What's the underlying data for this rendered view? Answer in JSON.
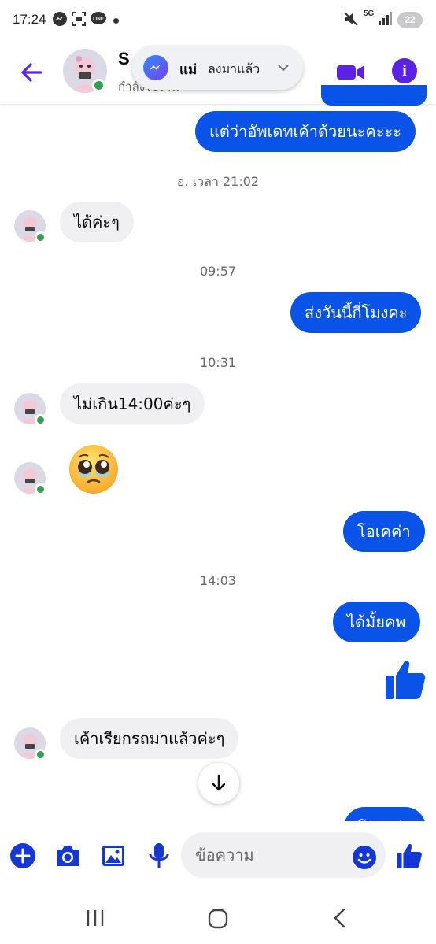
{
  "status_bar": {
    "time": "17:24",
    "network": "5G",
    "battery": "22"
  },
  "header": {
    "contact_name": "S",
    "contact_status": "กำลังใช้งาน",
    "accent_color": "#5b21e6"
  },
  "notification": {
    "sender": "แม่",
    "message": "ลงมาแล้ว"
  },
  "messages": [
    {
      "direction": "out",
      "text": "แต่ว่าอัพเดทเค้าด้วยนะคะะะ"
    },
    {
      "direction": "timestamp",
      "text": "อ. เวลา  21:02"
    },
    {
      "direction": "in",
      "text": "ได้ค่ะๆ"
    },
    {
      "direction": "timestamp",
      "text": "09:57"
    },
    {
      "direction": "out",
      "text": "ส่งวันนี้กี่โมงคะ"
    },
    {
      "direction": "timestamp",
      "text": "10:31"
    },
    {
      "direction": "in",
      "text": "ไม่เกิน14:00ค่ะๆ"
    },
    {
      "direction": "in",
      "text": "🥺",
      "emoji": "pleading-face"
    },
    {
      "direction": "out",
      "text": "โอเคค่า"
    },
    {
      "direction": "timestamp",
      "text": "14:03"
    },
    {
      "direction": "out",
      "text": "ได้มั้ยคพ"
    },
    {
      "direction": "out",
      "text": "",
      "sticker": "thumbs-up"
    },
    {
      "direction": "in",
      "text": "เค้าเรียกรถมาแล้วค่ะๆ"
    },
    {
      "direction": "out",
      "text": "โอเคค่า",
      "partially_hidden": true
    }
  ],
  "composer": {
    "placeholder": "ข้อความ"
  },
  "colors": {
    "outgoing_bubble": "#0a53e8",
    "incoming_bubble": "#f0f0f2",
    "composer_icons": "#1537d6",
    "online": "#31a24c"
  }
}
